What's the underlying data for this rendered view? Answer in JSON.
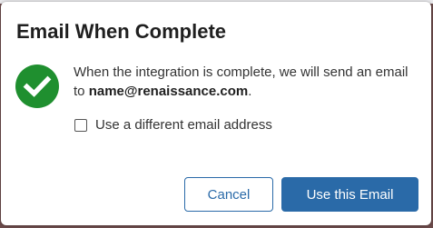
{
  "dialog": {
    "title": "Email When Complete",
    "message_prefix": "When the integration is complete, we will send an email to ",
    "email": "name@renaissance.com",
    "message_suffix": ".",
    "checkbox_label": "Use a different email address",
    "checkbox_checked": false,
    "cancel_label": "Cancel",
    "confirm_label": "Use this Email"
  },
  "icons": {
    "status": "check-circle-icon"
  },
  "colors": {
    "success": "#1f8f2f",
    "primary": "#2a6aa8"
  }
}
